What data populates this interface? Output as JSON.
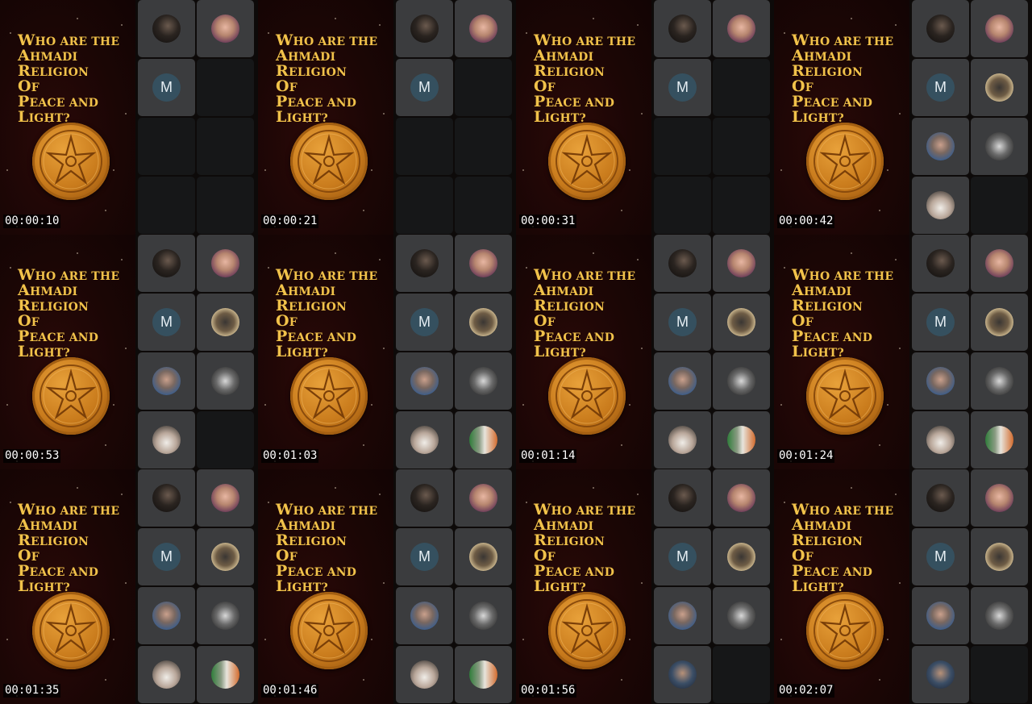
{
  "poster": {
    "title_lines": [
      "Who are the",
      "Ahmadi",
      "Religion",
      "Of",
      "Peace and",
      "Light?"
    ]
  },
  "frames": [
    {
      "timestamp": "00:00:10",
      "participants": [
        "photo-dark-hair",
        "photo-woman-flower-crown",
        "letter-m",
        "empty",
        "empty",
        "empty",
        "empty",
        "empty"
      ]
    },
    {
      "timestamp": "00:00:21",
      "participants": [
        "photo-dark-hair",
        "photo-woman-flower-crown",
        "letter-m",
        "empty",
        "empty",
        "empty",
        "empty",
        "empty"
      ]
    },
    {
      "timestamp": "00:00:31",
      "participants": [
        "photo-dark-hair",
        "photo-woman-flower-crown",
        "letter-m",
        "empty",
        "empty",
        "empty",
        "empty",
        "empty"
      ]
    },
    {
      "timestamp": "00:00:42",
      "participants": [
        "photo-dark-hair",
        "photo-woman-flower-crown",
        "letter-m",
        "photo-wolf",
        "photo-bearded-man",
        "photo-two-people-bw",
        "photo-man-white-shirt",
        "empty"
      ]
    },
    {
      "timestamp": "00:00:53",
      "participants": [
        "photo-dark-hair",
        "photo-woman-flower-crown",
        "letter-m",
        "photo-wolf",
        "photo-bearded-man",
        "photo-two-people-bw",
        "photo-man-white-shirt",
        "empty"
      ]
    },
    {
      "timestamp": "00:01:03",
      "participants": [
        "photo-dark-hair",
        "photo-woman-flower-crown",
        "letter-m",
        "photo-wolf",
        "photo-bearded-man",
        "photo-two-people-bw",
        "photo-man-white-shirt",
        "photo-flag-emblem"
      ]
    },
    {
      "timestamp": "00:01:14",
      "participants": [
        "photo-dark-hair",
        "photo-woman-flower-crown",
        "letter-m",
        "photo-wolf",
        "photo-bearded-man",
        "photo-two-people-bw",
        "photo-man-white-shirt",
        "photo-flag-emblem"
      ]
    },
    {
      "timestamp": "00:01:24",
      "participants": [
        "photo-dark-hair",
        "photo-woman-flower-crown",
        "letter-m",
        "photo-wolf",
        "photo-bearded-man",
        "photo-two-people-bw",
        "photo-man-white-shirt",
        "photo-flag-emblem"
      ]
    },
    {
      "timestamp": "00:01:35",
      "participants": [
        "photo-dark-hair",
        "photo-woman-flower-crown",
        "letter-m",
        "photo-wolf",
        "photo-bearded-man",
        "photo-two-people-bw",
        "photo-man-white-shirt",
        "photo-flag-emblem"
      ]
    },
    {
      "timestamp": "00:01:46",
      "participants": [
        "photo-dark-hair",
        "photo-woman-flower-crown",
        "letter-m",
        "photo-wolf",
        "photo-bearded-man",
        "photo-two-people-bw",
        "photo-man-white-shirt",
        "photo-flag-emblem"
      ]
    },
    {
      "timestamp": "00:01:56",
      "participants": [
        "photo-dark-hair",
        "photo-woman-flower-crown",
        "letter-m",
        "photo-wolf",
        "photo-bearded-man",
        "photo-two-people-bw",
        "photo-man-hoodie",
        "empty"
      ]
    },
    {
      "timestamp": "00:02:07",
      "participants": [
        "photo-dark-hair",
        "photo-woman-flower-crown",
        "letter-m",
        "photo-wolf",
        "photo-bearded-man",
        "photo-two-people-bw",
        "photo-man-hoodie",
        "empty"
      ]
    }
  ],
  "avatar_letter": "M",
  "colors": {
    "title_gold": "#f1c24a",
    "poster_maroon": "#1b0605",
    "coin_bronze": "#c97b1c",
    "tile_active": "#3b3c3e",
    "tile_empty": "#161718",
    "letter_avatar_bg": "#35505f"
  }
}
